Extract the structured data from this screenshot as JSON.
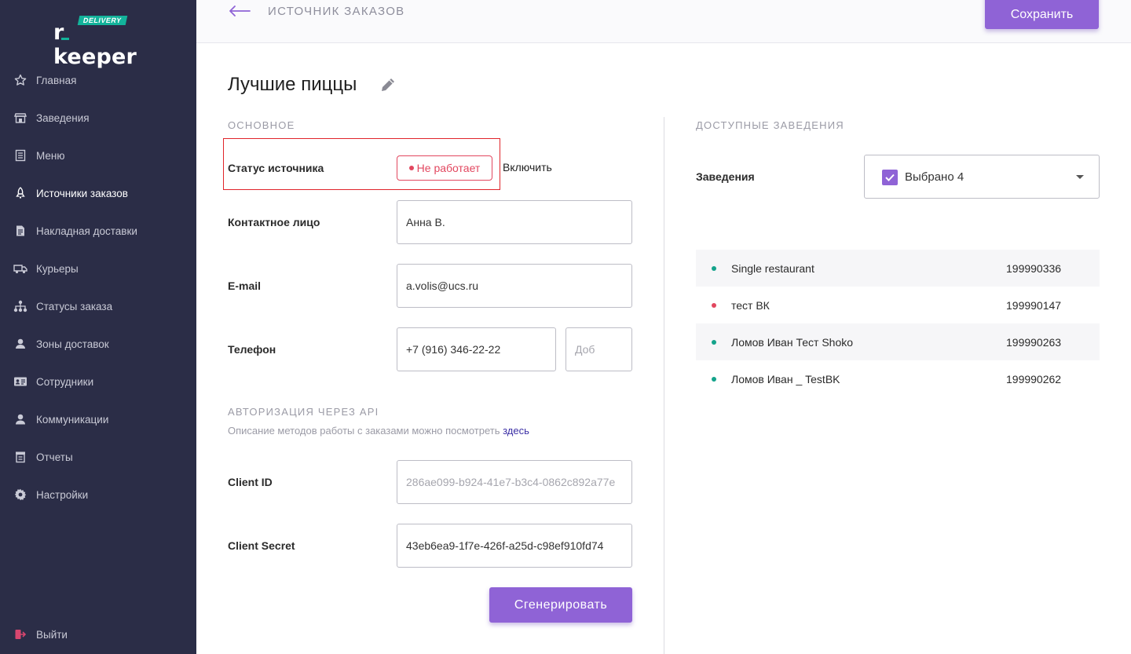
{
  "app": {
    "logo_text": "r_keeper",
    "logo_badge": "DELIVERY"
  },
  "sidebar": {
    "items": [
      {
        "label": "Главная",
        "icon": "star-icon"
      },
      {
        "label": "Заведения",
        "icon": "store-icon"
      },
      {
        "label": "Меню",
        "icon": "menu-icon"
      },
      {
        "label": "Источники заказов",
        "icon": "rocket-icon"
      },
      {
        "label": "Накладная доставки",
        "icon": "document-icon"
      },
      {
        "label": "Курьеры",
        "icon": "truck-icon"
      },
      {
        "label": "Статусы заказа",
        "icon": "hierarchy-icon"
      },
      {
        "label": "Зоны доставок",
        "icon": "location-user-icon"
      },
      {
        "label": "Сотрудники",
        "icon": "id-card-icon"
      },
      {
        "label": "Коммуникации",
        "icon": "user-icon"
      },
      {
        "label": "Отчеты",
        "icon": "report-icon"
      },
      {
        "label": "Настройки",
        "icon": "gear-icon"
      }
    ],
    "active_index": 3,
    "logout_label": "Выйти"
  },
  "header": {
    "title": "ИСТОЧНИК ЗАКАЗОВ",
    "save_label": "Сохранить"
  },
  "main": {
    "title": "Лучшие пиццы",
    "section_basic": "ОСНОВНОЕ",
    "status": {
      "label": "Статус источника",
      "value": "Не работает",
      "action": "Включить"
    },
    "contact": {
      "label": "Контактное лицо",
      "value": "Анна В."
    },
    "email": {
      "label": "E-mail",
      "value": "a.volis@ucs.ru"
    },
    "phone": {
      "label": "Телефон",
      "value": "+7 (916) 346-22-22",
      "ext_placeholder": "Доб"
    },
    "section_api": "АВТОРИЗАЦИЯ ЧЕРЕЗ API",
    "api_desc": "Описание методов работы с заказами можно посмотреть",
    "api_link": "здесь",
    "client_id": {
      "label": "Client ID",
      "placeholder": "286ae099-b924-41e7-b3c4-0862c892a77e"
    },
    "client_secret": {
      "label": "Client Secret",
      "value": "43eb6ea9-1f7e-426f-a25d-c98ef910fd74"
    },
    "generate_label": "Сгенерировать"
  },
  "right": {
    "section": "ДОСТУПНЫЕ ЗАВЕДЕНИЯ",
    "venues_label": "Заведения",
    "selected_text": "Выбрано 4",
    "venues": [
      {
        "name": "Single restaurant",
        "id": "199990336",
        "status_color": "#14a38b"
      },
      {
        "name": "тест ВК",
        "id": "199990147",
        "status_color": "#e2475f"
      },
      {
        "name": "Ломов Иван Тест Shoko",
        "id": "199990263",
        "status_color": "#14a38b"
      },
      {
        "name": "Ломов Иван _ TestBK",
        "id": "199990262",
        "status_color": "#14a38b"
      }
    ]
  },
  "colors": {
    "sidebar_bg": "#2b2d47",
    "accent": "#8f63d6",
    "error": "#e2475f",
    "success": "#14a38b",
    "logout_icon": "#d8466f"
  }
}
